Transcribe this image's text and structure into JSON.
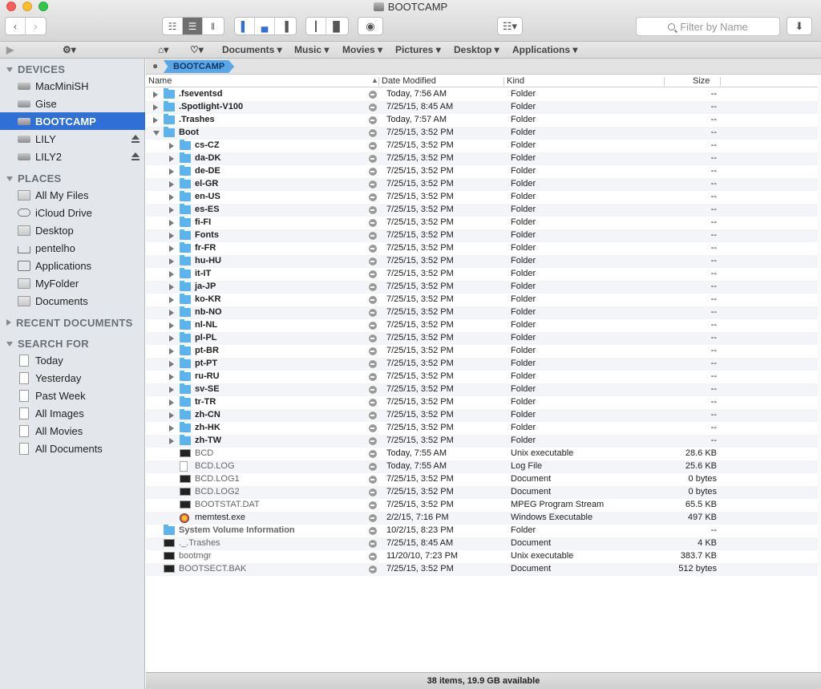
{
  "window": {
    "title": "BOOTCAMP"
  },
  "toolbar": {
    "filter_placeholder": "Filter by Name"
  },
  "pathbar": {
    "items": [
      "Documents",
      "Music",
      "Movies",
      "Pictures",
      "Desktop",
      "Applications"
    ],
    "current": "BOOTCAMP"
  },
  "sidebar": {
    "devices_label": "DEVICES",
    "devices": [
      "MacMiniSH",
      "Gise",
      "BOOTCAMP",
      "LILY",
      "LILY2"
    ],
    "places_label": "PLACES",
    "places": [
      "All My Files",
      "iCloud Drive",
      "Desktop",
      "pentelho",
      "Applications",
      "MyFolder",
      "Documents"
    ],
    "recent_label": "RECENT DOCUMENTS",
    "search_label": "SEARCH FOR",
    "search": [
      "Today",
      "Yesterday",
      "Past Week",
      "All Images",
      "All Movies",
      "All Documents"
    ]
  },
  "columns": {
    "name": "Name",
    "date": "Date Modified",
    "kind": "Kind",
    "size": "Size"
  },
  "files": [
    {
      "name": ".fseventsd",
      "date": "Today, 7:56 AM",
      "kind": "Folder",
      "size": "--",
      "depth": 0,
      "disclosure": "right",
      "icon": "folder",
      "style": "bold"
    },
    {
      "name": ".Spotlight-V100",
      "date": "7/25/15, 8:45 AM",
      "kind": "Folder",
      "size": "--",
      "depth": 0,
      "disclosure": "right",
      "icon": "folder",
      "style": "bold"
    },
    {
      "name": ".Trashes",
      "date": "Today, 7:57 AM",
      "kind": "Folder",
      "size": "--",
      "depth": 0,
      "disclosure": "right",
      "icon": "folder",
      "style": "bold"
    },
    {
      "name": "Boot",
      "date": "7/25/15, 3:52 PM",
      "kind": "Folder",
      "size": "--",
      "depth": 0,
      "disclosure": "down",
      "icon": "folder",
      "style": "bold"
    },
    {
      "name": "cs-CZ",
      "date": "7/25/15, 3:52 PM",
      "kind": "Folder",
      "size": "--",
      "depth": 1,
      "disclosure": "right",
      "icon": "folder",
      "style": "bold"
    },
    {
      "name": "da-DK",
      "date": "7/25/15, 3:52 PM",
      "kind": "Folder",
      "size": "--",
      "depth": 1,
      "disclosure": "right",
      "icon": "folder",
      "style": "bold"
    },
    {
      "name": "de-DE",
      "date": "7/25/15, 3:52 PM",
      "kind": "Folder",
      "size": "--",
      "depth": 1,
      "disclosure": "right",
      "icon": "folder",
      "style": "bold"
    },
    {
      "name": "el-GR",
      "date": "7/25/15, 3:52 PM",
      "kind": "Folder",
      "size": "--",
      "depth": 1,
      "disclosure": "right",
      "icon": "folder",
      "style": "bold"
    },
    {
      "name": "en-US",
      "date": "7/25/15, 3:52 PM",
      "kind": "Folder",
      "size": "--",
      "depth": 1,
      "disclosure": "right",
      "icon": "folder",
      "style": "bold"
    },
    {
      "name": "es-ES",
      "date": "7/25/15, 3:52 PM",
      "kind": "Folder",
      "size": "--",
      "depth": 1,
      "disclosure": "right",
      "icon": "folder",
      "style": "bold"
    },
    {
      "name": "fi-FI",
      "date": "7/25/15, 3:52 PM",
      "kind": "Folder",
      "size": "--",
      "depth": 1,
      "disclosure": "right",
      "icon": "folder",
      "style": "bold"
    },
    {
      "name": "Fonts",
      "date": "7/25/15, 3:52 PM",
      "kind": "Folder",
      "size": "--",
      "depth": 1,
      "disclosure": "right",
      "icon": "folder",
      "style": "bold"
    },
    {
      "name": "fr-FR",
      "date": "7/25/15, 3:52 PM",
      "kind": "Folder",
      "size": "--",
      "depth": 1,
      "disclosure": "right",
      "icon": "folder",
      "style": "bold"
    },
    {
      "name": "hu-HU",
      "date": "7/25/15, 3:52 PM",
      "kind": "Folder",
      "size": "--",
      "depth": 1,
      "disclosure": "right",
      "icon": "folder",
      "style": "bold"
    },
    {
      "name": "it-IT",
      "date": "7/25/15, 3:52 PM",
      "kind": "Folder",
      "size": "--",
      "depth": 1,
      "disclosure": "right",
      "icon": "folder",
      "style": "bold"
    },
    {
      "name": "ja-JP",
      "date": "7/25/15, 3:52 PM",
      "kind": "Folder",
      "size": "--",
      "depth": 1,
      "disclosure": "right",
      "icon": "folder",
      "style": "bold"
    },
    {
      "name": "ko-KR",
      "date": "7/25/15, 3:52 PM",
      "kind": "Folder",
      "size": "--",
      "depth": 1,
      "disclosure": "right",
      "icon": "folder",
      "style": "bold"
    },
    {
      "name": "nb-NO",
      "date": "7/25/15, 3:52 PM",
      "kind": "Folder",
      "size": "--",
      "depth": 1,
      "disclosure": "right",
      "icon": "folder",
      "style": "bold"
    },
    {
      "name": "nl-NL",
      "date": "7/25/15, 3:52 PM",
      "kind": "Folder",
      "size": "--",
      "depth": 1,
      "disclosure": "right",
      "icon": "folder",
      "style": "bold"
    },
    {
      "name": "pl-PL",
      "date": "7/25/15, 3:52 PM",
      "kind": "Folder",
      "size": "--",
      "depth": 1,
      "disclosure": "right",
      "icon": "folder",
      "style": "bold"
    },
    {
      "name": "pt-BR",
      "date": "7/25/15, 3:52 PM",
      "kind": "Folder",
      "size": "--",
      "depth": 1,
      "disclosure": "right",
      "icon": "folder",
      "style": "bold"
    },
    {
      "name": "pt-PT",
      "date": "7/25/15, 3:52 PM",
      "kind": "Folder",
      "size": "--",
      "depth": 1,
      "disclosure": "right",
      "icon": "folder",
      "style": "bold"
    },
    {
      "name": "ru-RU",
      "date": "7/25/15, 3:52 PM",
      "kind": "Folder",
      "size": "--",
      "depth": 1,
      "disclosure": "right",
      "icon": "folder",
      "style": "bold"
    },
    {
      "name": "sv-SE",
      "date": "7/25/15, 3:52 PM",
      "kind": "Folder",
      "size": "--",
      "depth": 1,
      "disclosure": "right",
      "icon": "folder",
      "style": "bold"
    },
    {
      "name": "tr-TR",
      "date": "7/25/15, 3:52 PM",
      "kind": "Folder",
      "size": "--",
      "depth": 1,
      "disclosure": "right",
      "icon": "folder",
      "style": "bold"
    },
    {
      "name": "zh-CN",
      "date": "7/25/15, 3:52 PM",
      "kind": "Folder",
      "size": "--",
      "depth": 1,
      "disclosure": "right",
      "icon": "folder",
      "style": "bold"
    },
    {
      "name": "zh-HK",
      "date": "7/25/15, 3:52 PM",
      "kind": "Folder",
      "size": "--",
      "depth": 1,
      "disclosure": "right",
      "icon": "folder",
      "style": "bold"
    },
    {
      "name": "zh-TW",
      "date": "7/25/15, 3:52 PM",
      "kind": "Folder",
      "size": "--",
      "depth": 1,
      "disclosure": "right",
      "icon": "folder",
      "style": "bold"
    },
    {
      "name": "BCD",
      "date": "Today, 7:55 AM",
      "kind": "Unix executable",
      "size": "28.6 KB",
      "depth": 1,
      "disclosure": "none",
      "icon": "exec",
      "style": "dim"
    },
    {
      "name": "BCD.LOG",
      "date": "Today, 7:55 AM",
      "kind": "Log File",
      "size": "25.6 KB",
      "depth": 1,
      "disclosure": "none",
      "icon": "doc",
      "style": "dim"
    },
    {
      "name": "BCD.LOG1",
      "date": "7/25/15, 3:52 PM",
      "kind": "Document",
      "size": "0 bytes",
      "depth": 1,
      "disclosure": "none",
      "icon": "exec",
      "style": "dim"
    },
    {
      "name": "BCD.LOG2",
      "date": "7/25/15, 3:52 PM",
      "kind": "Document",
      "size": "0 bytes",
      "depth": 1,
      "disclosure": "none",
      "icon": "exec",
      "style": "dim"
    },
    {
      "name": "BOOTSTAT.DAT",
      "date": "7/25/15, 3:52 PM",
      "kind": "MPEG Program Stream",
      "size": "65.5 KB",
      "depth": 1,
      "disclosure": "none",
      "icon": "exec",
      "style": "dim"
    },
    {
      "name": "memtest.exe",
      "date": "2/2/15, 7:16 PM",
      "kind": "Windows Executable",
      "size": "497 KB",
      "depth": 1,
      "disclosure": "none",
      "icon": "memtest",
      "style": "normal"
    },
    {
      "name": "System Volume Information",
      "date": "10/2/15, 8:23 PM",
      "kind": "Folder",
      "size": "--",
      "depth": 0,
      "disclosure": "none",
      "icon": "folder",
      "style": "bolddim"
    },
    {
      "name": "._.Trashes",
      "date": "7/25/15, 8:45 AM",
      "kind": "Document",
      "size": "4 KB",
      "depth": 0,
      "disclosure": "none",
      "icon": "exec",
      "style": "dim"
    },
    {
      "name": "bootmgr",
      "date": "11/20/10, 7:23 PM",
      "kind": "Unix executable",
      "size": "383.7 KB",
      "depth": 0,
      "disclosure": "none",
      "icon": "exec",
      "style": "dim"
    },
    {
      "name": "BOOTSECT.BAK",
      "date": "7/25/15, 3:52 PM",
      "kind": "Document",
      "size": "512 bytes",
      "depth": 0,
      "disclosure": "none",
      "icon": "exec",
      "style": "dim"
    }
  ],
  "status": "38 items, 19.9 GB available"
}
